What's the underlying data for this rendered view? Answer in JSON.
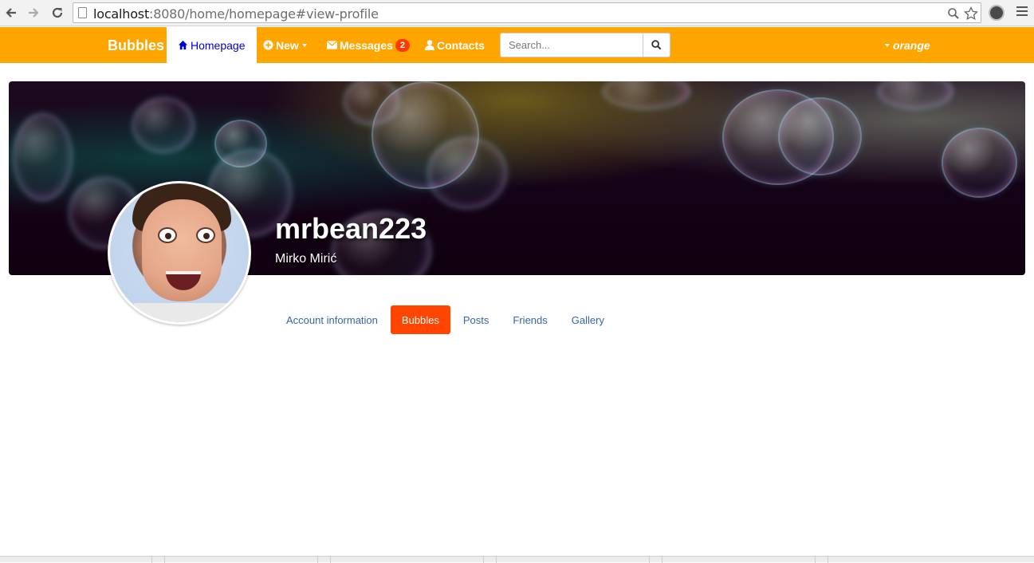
{
  "browser": {
    "url_host": "localhost",
    "url_rest": ":8080/home/homepage#view-profile",
    "back_icon": "arrow-left-icon",
    "forward_icon": "arrow-right-icon",
    "reload_icon": "reload-icon"
  },
  "navbar": {
    "brand": "Bubbles",
    "items": [
      {
        "label": "Homepage",
        "icon": "home-icon"
      },
      {
        "label": "New",
        "icon": "plus-circle-icon"
      },
      {
        "label": "Messages",
        "icon": "envelope-icon",
        "badge": "2"
      },
      {
        "label": "Contacts",
        "icon": "user-icon"
      }
    ],
    "search": {
      "placeholder": "Search..."
    },
    "user": "orange",
    "accent": "#ffa500"
  },
  "profile": {
    "username": "mrbean223",
    "full_name": "Mirko Mirić"
  },
  "tabs": [
    {
      "label": "Account information",
      "active": false
    },
    {
      "label": "Bubbles",
      "active": true
    },
    {
      "label": "Posts",
      "active": false
    },
    {
      "label": "Friends",
      "active": false
    },
    {
      "label": "Gallery",
      "active": false
    }
  ],
  "colors": {
    "active_tab": "#ff4500",
    "badge": "#ff3b00",
    "link": "#3366aa"
  }
}
